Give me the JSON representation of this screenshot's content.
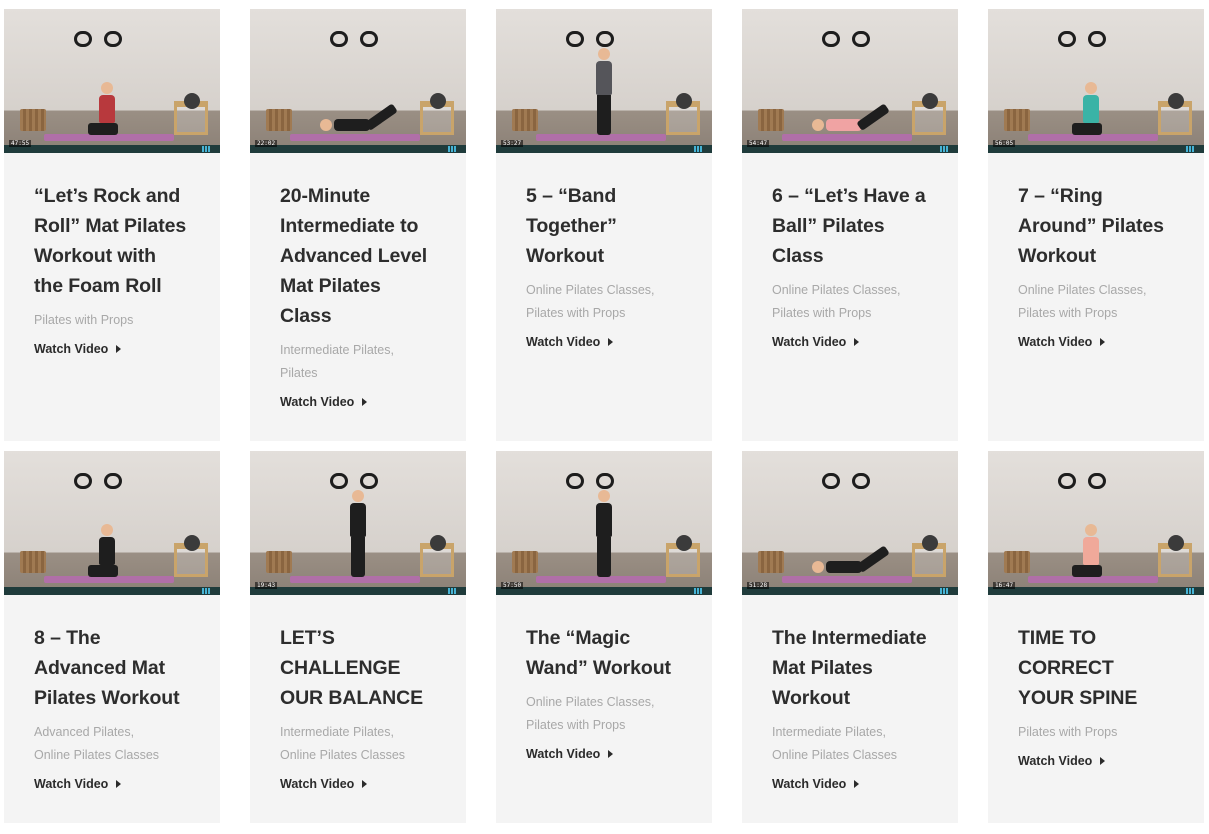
{
  "cards": [
    {
      "title": "“Let’s Rock and Roll” Mat Pilates Workout with the Foam Roll",
      "categories": [
        "Pilates with Props"
      ],
      "cta": "Watch Video",
      "duration": "47:55",
      "progress": 0,
      "outfit": "#b8393d",
      "scene": "sit"
    },
    {
      "title": "20-Minute Intermediate to Advanced Level Mat Pilates Class",
      "categories": [
        "Intermediate Pilates,",
        "Pilates"
      ],
      "cta": "Watch Video",
      "duration": "22:02",
      "progress": 0,
      "outfit": "#1e1e1e",
      "scene": "lie"
    },
    {
      "title": "5 – “Band Together” Workout",
      "categories": [
        "Online Pilates Classes,",
        "Pilates with Props"
      ],
      "cta": "Watch Video",
      "duration": "53:27",
      "progress": 0,
      "outfit": "#55555a",
      "scene": "stand"
    },
    {
      "title": "6 – “Let’s Have a Ball” Pilates Class",
      "categories": [
        "Online Pilates Classes,",
        "Pilates with Props"
      ],
      "cta": "Watch Video",
      "duration": "54:47",
      "progress": 0,
      "outfit": "#f0a3a3",
      "scene": "lie"
    },
    {
      "title": "7 – “Ring Around” Pilates Workout",
      "categories": [
        "Online Pilates Classes,",
        "Pilates with Props"
      ],
      "cta": "Watch Video",
      "duration": "56:05",
      "progress": 0,
      "outfit": "#3ab3a6",
      "scene": "sit"
    },
    {
      "title": "8 – The Advanced Mat Pilates Workout",
      "categories": [
        "Advanced Pilates,",
        "Online Pilates Classes"
      ],
      "cta": "Watch Video",
      "duration": "",
      "progress": 0,
      "outfit": "#1e1e1e",
      "scene": "sit"
    },
    {
      "title": "LET’S CHALLENGE OUR BALANCE",
      "categories": [
        "Intermediate Pilates,",
        "Online Pilates Classes"
      ],
      "cta": "Watch Video",
      "duration": "19:43",
      "progress": 0,
      "outfit": "#1e1e1e",
      "scene": "stand"
    },
    {
      "title": "The “Magic Wand” Workout",
      "categories": [
        "Online Pilates Classes,",
        "Pilates with Props"
      ],
      "cta": "Watch Video",
      "duration": "57:50",
      "progress": 0,
      "outfit": "#1e1e1e",
      "scene": "stand"
    },
    {
      "title": "The Intermediate Mat Pilates Workout",
      "categories": [
        "Intermediate Pilates,",
        "Online Pilates Classes"
      ],
      "cta": "Watch Video",
      "duration": "51:28",
      "progress": 0,
      "outfit": "#1e1e1e",
      "scene": "lie"
    },
    {
      "title": "TIME TO CORRECT YOUR SPINE",
      "categories": [
        "Pilates with Props"
      ],
      "cta": "Watch Video",
      "duration": "16:47",
      "progress": 0,
      "outfit": "#f0a99a",
      "scene": "sit"
    }
  ]
}
